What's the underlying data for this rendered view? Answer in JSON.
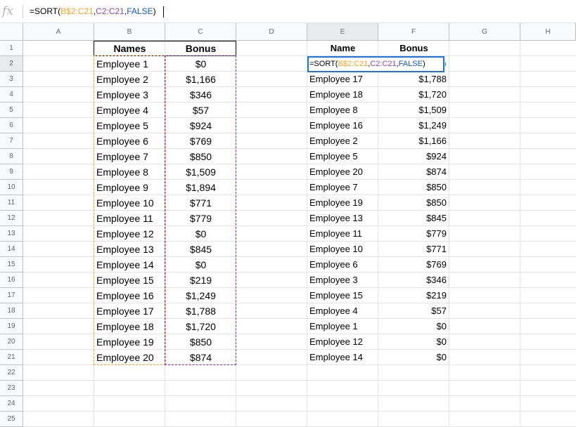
{
  "formula_bar": {
    "fx_label": "fx",
    "formula_parts": [
      "=SORT(",
      "B$2:C21",
      ",",
      "C2:C21",
      ",",
      "FALSE",
      ")"
    ]
  },
  "columns": [
    "A",
    "B",
    "C",
    "D",
    "E",
    "F",
    "G",
    "H"
  ],
  "rows": [
    "1",
    "2",
    "3",
    "4",
    "5",
    "6",
    "7",
    "8",
    "9",
    "10",
    "11",
    "12",
    "13",
    "14",
    "15",
    "16",
    "17",
    "18",
    "19",
    "20",
    "21",
    "22",
    "23",
    "24",
    "25"
  ],
  "source_table": {
    "headers": [
      "Names",
      "Bonus"
    ],
    "rows": [
      [
        "Employee 1",
        "$0"
      ],
      [
        "Employee 2",
        "$1,166"
      ],
      [
        "Employee 3",
        "$346"
      ],
      [
        "Employee 4",
        "$57"
      ],
      [
        "Employee 5",
        "$924"
      ],
      [
        "Employee 6",
        "$769"
      ],
      [
        "Employee 7",
        "$850"
      ],
      [
        "Employee 8",
        "$1,509"
      ],
      [
        "Employee 9",
        "$1,894"
      ],
      [
        "Employee 10",
        "$771"
      ],
      [
        "Employee 11",
        "$779"
      ],
      [
        "Employee 12",
        "$0"
      ],
      [
        "Employee 13",
        "$845"
      ],
      [
        "Employee 14",
        "$0"
      ],
      [
        "Employee 15",
        "$219"
      ],
      [
        "Employee 16",
        "$1,249"
      ],
      [
        "Employee 17",
        "$1,788"
      ],
      [
        "Employee 18",
        "$1,720"
      ],
      [
        "Employee 19",
        "$850"
      ],
      [
        "Employee 20",
        "$874"
      ]
    ]
  },
  "sorted_table": {
    "headers": [
      "Name",
      "Bonus"
    ],
    "editing_cell": [
      "=SORT(",
      "B$2:C21",
      ",",
      "C2:C21",
      ",",
      "FALSE",
      ")"
    ],
    "rows": [
      [
        "Employee 17",
        "$1,788"
      ],
      [
        "Employee 18",
        "$1,720"
      ],
      [
        "Employee 8",
        "$1,509"
      ],
      [
        "Employee 16",
        "$1,249"
      ],
      [
        "Employee 2",
        "$1,166"
      ],
      [
        "Employee 5",
        "$924"
      ],
      [
        "Employee 20",
        "$874"
      ],
      [
        "Employee 7",
        "$850"
      ],
      [
        "Employee 19",
        "$850"
      ],
      [
        "Employee 13",
        "$845"
      ],
      [
        "Employee 11",
        "$779"
      ],
      [
        "Employee 10",
        "$771"
      ],
      [
        "Employee 6",
        "$769"
      ],
      [
        "Employee 3",
        "$346"
      ],
      [
        "Employee 15",
        "$219"
      ],
      [
        "Employee 4",
        "$57"
      ],
      [
        "Employee 1",
        "$0"
      ],
      [
        "Employee 12",
        "$0"
      ],
      [
        "Employee 14",
        "$0"
      ]
    ]
  },
  "colors": {
    "range_orange": "#f5a623",
    "range_purple": "#8e44ad",
    "keyword_blue": "#1155cc",
    "selection_blue": "#1a73e8"
  }
}
